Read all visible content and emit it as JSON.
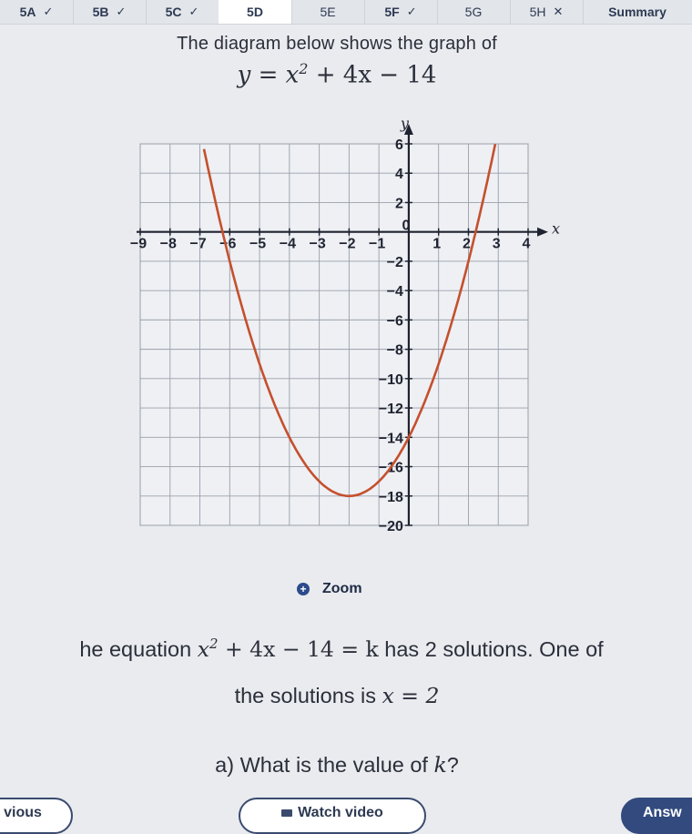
{
  "tabs": [
    {
      "label": "5A",
      "status": "check",
      "symbol": "✓"
    },
    {
      "label": "5B",
      "status": "check",
      "symbol": "✓"
    },
    {
      "label": "5C",
      "status": "check",
      "symbol": "✓"
    },
    {
      "label": "5D",
      "status": "active",
      "symbol": ""
    },
    {
      "label": "5E",
      "status": "none",
      "symbol": ""
    },
    {
      "label": "5F",
      "status": "check",
      "symbol": "✓"
    },
    {
      "label": "5G",
      "status": "none",
      "symbol": ""
    },
    {
      "label": "5H",
      "status": "cross",
      "symbol": "✕"
    },
    {
      "label": "Summary",
      "status": "none",
      "symbol": ""
    }
  ],
  "question": {
    "intro": "The diagram below shows the graph of",
    "equation": {
      "lhs": "y",
      "eq": "=",
      "x": "x",
      "exp": "2",
      "rest": "+ 4x − 14"
    }
  },
  "chart_data": {
    "type": "line",
    "xlabel": "x",
    "ylabel": "y",
    "xlim": [
      -9,
      4
    ],
    "ylim": [
      -20,
      6
    ],
    "x_ticks": [
      "-9",
      "-8",
      "-7",
      "-6",
      "-5",
      "-4",
      "-3",
      "-2",
      "-1",
      "0",
      "1",
      "2",
      "3",
      "4"
    ],
    "y_ticks": [
      "6",
      "4",
      "2",
      "-2",
      "-4",
      "-6",
      "-8",
      "-10",
      "-12",
      "-14",
      "-16",
      "-18",
      "-20"
    ],
    "series": [
      {
        "function": "x^2 + 4x - 14",
        "color": "#c5502d",
        "x_range": [
          -8.5,
          4.6
        ]
      }
    ],
    "grid": true
  },
  "zoom": {
    "label": "Zoom",
    "icon": "zoom-in-icon"
  },
  "body": {
    "p1_start": "he equation",
    "p1_math": {
      "x": "x",
      "exp": "2",
      "rest": "+ 4x − 14 = k"
    },
    "p1_end": "has 2 solutions. One of",
    "p2_start": "the solutions is",
    "p2_math": "x = 2",
    "part_a": "a) What is the value of",
    "part_a_var": "k",
    "part_a_end": "?"
  },
  "buttons": {
    "previous": "vious",
    "watch_video": "Watch video",
    "answer": "Answ"
  },
  "colors": {
    "curve": "#c5502d",
    "accent": "#324a7d"
  }
}
